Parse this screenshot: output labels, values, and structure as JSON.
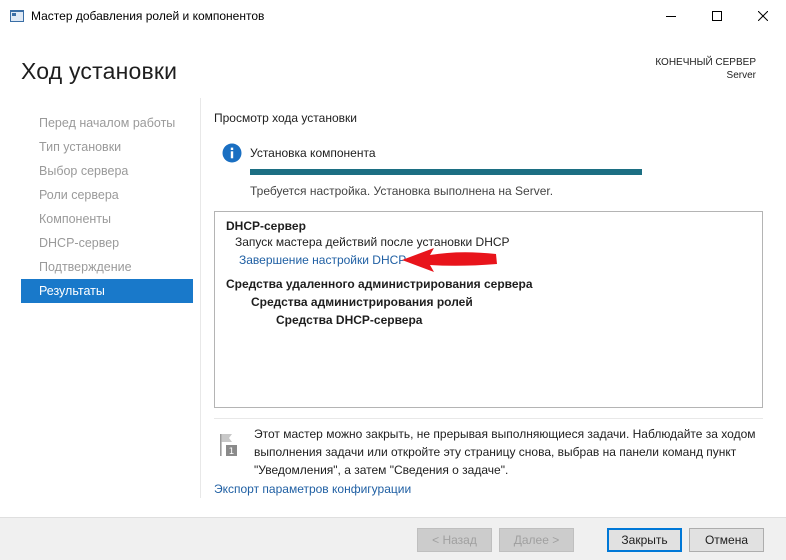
{
  "window": {
    "title": "Мастер добавления ролей и компонентов"
  },
  "header": {
    "title": "Ход установки",
    "destination_label": "КОНЕЧНЫЙ СЕРВЕР",
    "destination_value": "Server"
  },
  "nav": {
    "items": [
      {
        "label": "Перед началом работы",
        "active": false
      },
      {
        "label": "Тип установки",
        "active": false
      },
      {
        "label": "Выбор сервера",
        "active": false
      },
      {
        "label": "Роли сервера",
        "active": false
      },
      {
        "label": "Компоненты",
        "active": false
      },
      {
        "label": "DHCP-сервер",
        "active": false
      },
      {
        "label": "Подтверждение",
        "active": false
      },
      {
        "label": "Результаты",
        "active": true
      }
    ]
  },
  "progress": {
    "section_title": "Просмотр хода установки",
    "status_title": "Установка компонента",
    "percent": 100,
    "status_text": "Требуется настройка. Установка выполнена на Server."
  },
  "results": {
    "group1_title": "DHCP-сервер",
    "group1_item": "Запуск мастера действий после установки DHCP",
    "group1_link": "Завершение настройки DHCP",
    "group2_title": "Средства удаленного администрирования сервера",
    "group2_sub": "Средства администрирования ролей",
    "group2_subsub": "Средства DHCP-сервера"
  },
  "note": {
    "text": "Этот мастер можно закрыть, не прерывая выполняющиеся задачи. Наблюдайте за ходом выполнения задачи или откройте эту страницу снова, выбрав на панели команд пункт \"Уведомления\", а затем \"Сведения о задаче\".",
    "badge": "1"
  },
  "export_link": "Экспорт параметров конфигурации",
  "buttons": {
    "back": "< Назад",
    "next": "Далее >",
    "close": "Закрыть",
    "cancel": "Отмена"
  },
  "colors": {
    "accent": "#1979ca",
    "progress": "#1c6f83",
    "link": "#1f5fa3",
    "annotation_arrow": "#e8141b"
  }
}
